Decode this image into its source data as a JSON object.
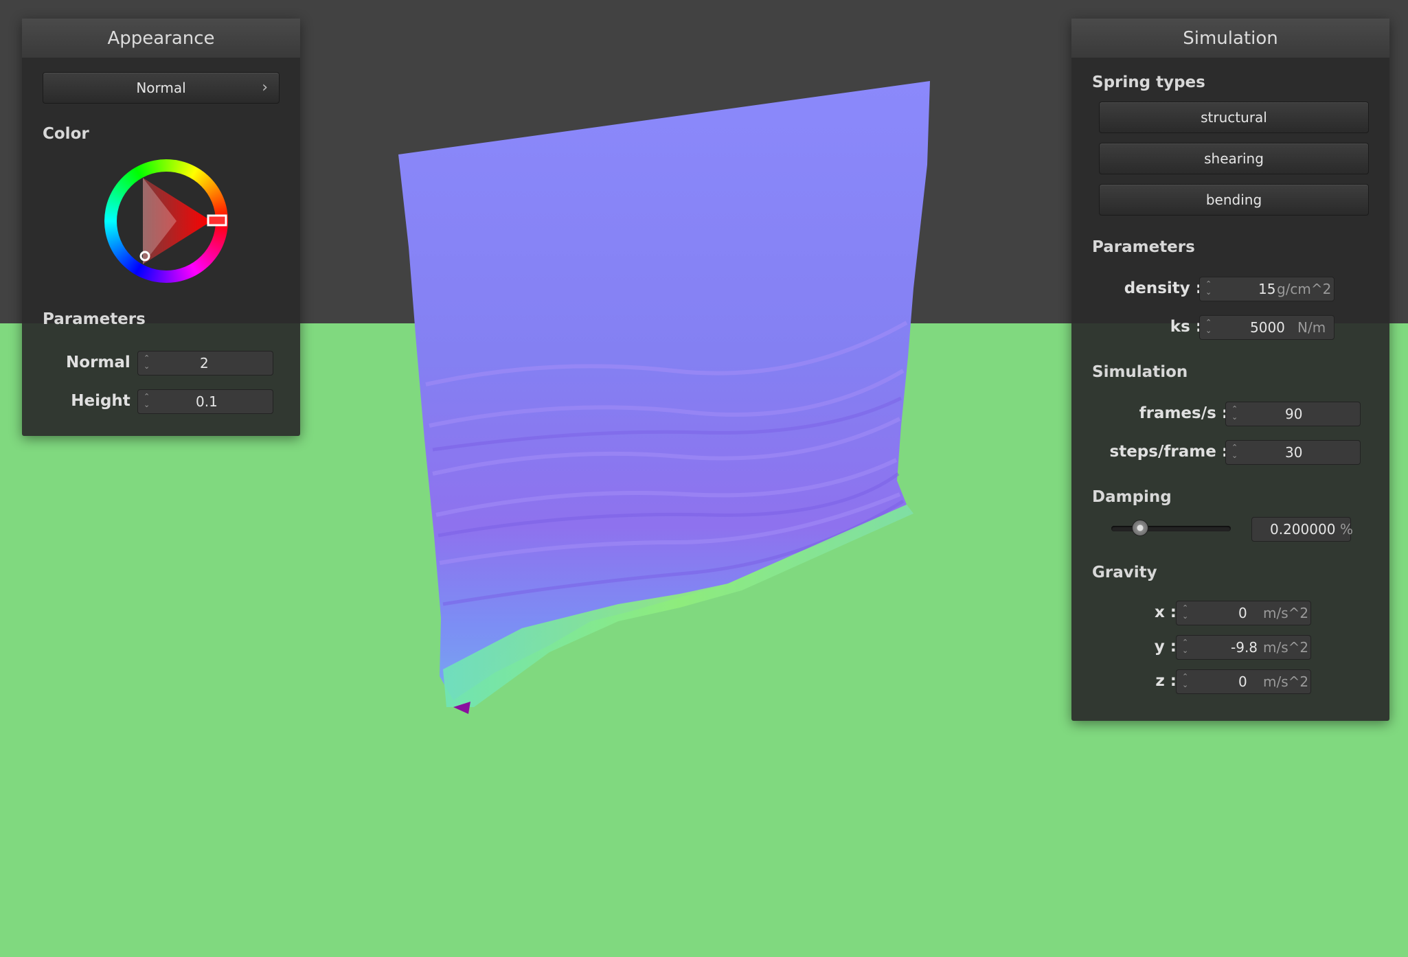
{
  "appearance": {
    "title": "Appearance",
    "shader_select": "Normal",
    "color_label": "Color",
    "params_label": "Parameters",
    "normal_label": "Normal :",
    "normal_value": "2",
    "height_label": "Height :",
    "height_value": "0.1",
    "selected_color": "#ff0000"
  },
  "simulation": {
    "title": "Simulation",
    "spring_types_label": "Spring types",
    "spring_buttons": [
      "structural",
      "shearing",
      "bending"
    ],
    "parameters_label": "Parameters",
    "density_label": "density :",
    "density_value": "15",
    "density_unit": "g/cm^2",
    "ks_label": "ks :",
    "ks_value": "5000",
    "ks_unit": "N/m",
    "sim_label": "Simulation",
    "fps_label": "frames/s :",
    "fps_value": "90",
    "steps_label": "steps/frame :",
    "steps_value": "30",
    "damping_label": "Damping",
    "damping_value": "0.200000",
    "damping_unit": "%",
    "damping_slider_fraction": 0.2,
    "gravity_label": "Gravity",
    "gx_label": "x :",
    "gx_value": "0",
    "gy_label": "y :",
    "gy_value": "-9.8",
    "gz_label": "z :",
    "gz_value": "0",
    "gravity_unit": "m/s^2"
  },
  "colors": {
    "ground": "#80d97f",
    "sky": "#424242",
    "cloth": "#8a86f5"
  }
}
